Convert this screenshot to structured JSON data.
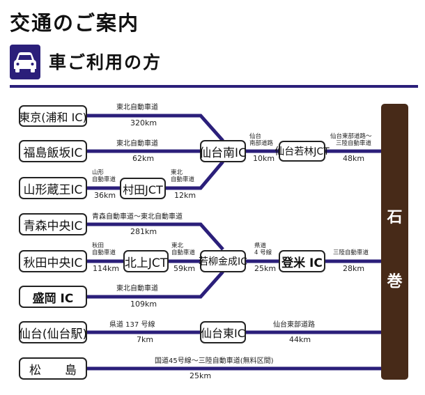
{
  "header": {
    "title": "交通のご案内",
    "section_icon": "car-icon",
    "section_title": "車ご利用の方"
  },
  "colors": {
    "accent": "#2b1f7a",
    "route_line": "#2b1f7a",
    "destination_bar": "#472a18"
  },
  "destination": {
    "char1": "石",
    "char2": "巻"
  },
  "origins": {
    "tokyo": "東京(浦和 IC)",
    "fukushima": "福島飯坂IC",
    "yamagata": "山形蔵王IC",
    "aomori": "青森中央IC",
    "akita": "秋田中央IC",
    "morioka": "盛岡 IC",
    "sendai_station": "仙台(仙台駅)",
    "matsushima": "松　　島"
  },
  "junctions": {
    "murata": "村田JCT",
    "sendai_minami": "仙台南IC",
    "sendai_wakabayashi": "仙台若林JCT",
    "kitakami": "北上JCT",
    "wakayanagi": "若柳金成IC",
    "tome": "登米 IC",
    "sendai_higashi": "仙台東IC"
  },
  "segments": {
    "tokyo_road": "東北自動車道",
    "tokyo_km": "320km",
    "fukushima_road": "東北自動車道",
    "fukushima_km": "62km",
    "yamagata_road_1": "山形",
    "yamagata_road_2": "自動車道",
    "yamagata_km": "36km",
    "murata_road_1": "東北",
    "murata_road_2": "自動車道",
    "murata_km": "12km",
    "minami_road_1": "仙台",
    "minami_road_2": "南部道路",
    "minami_km": "10km",
    "wakabayashi_road_1": "仙台東部道路～",
    "wakabayashi_road_2": "三陸自動車道",
    "wakabayashi_km": "48km",
    "aomori_road": "青森自動車道～東北自動車道",
    "aomori_km": "281km",
    "akita_road_1": "秋田",
    "akita_road_2": "自動車道",
    "akita_km": "114km",
    "kitakami_road_1": "東北",
    "kitakami_road_2": "自動車道",
    "kitakami_km": "59km",
    "morioka_road": "東北自動車道",
    "morioka_km": "109km",
    "wakayanagi_road_1": "県道",
    "wakayanagi_road_2": "4 号線",
    "wakayanagi_km": "25km",
    "tome_road": "三陸自動車道",
    "tome_km": "28km",
    "sendai_station_road": "県道 137 号線",
    "sendai_station_km": "7km",
    "higashi_road": "仙台東部道路",
    "higashi_km": "44km",
    "matsushima_road": "国道45号線～三陸自動車道(無料区間)",
    "matsushima_km": "25km"
  }
}
